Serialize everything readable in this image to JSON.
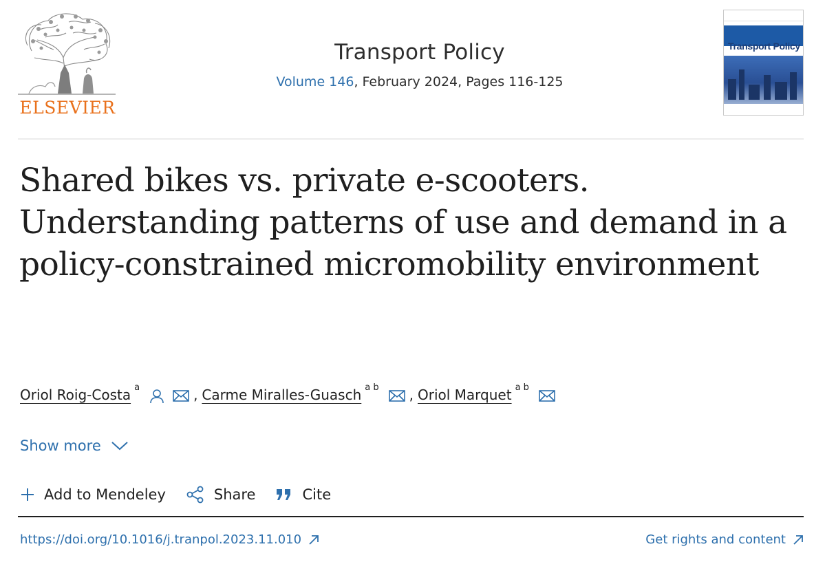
{
  "publisher": {
    "name": "ELSEVIER",
    "brand_color": "#e9711c",
    "logo_icon": "tree-logo-icon"
  },
  "journal": {
    "title": "Transport Policy",
    "volume_link": "Volume 146",
    "issue_rest": ", February 2024, Pages 116-125",
    "cover_journal_title": "Transport Policy"
  },
  "article": {
    "title": "Shared bikes vs. private e-scooters. Understanding patterns of use and demand in a policy-constrained micromobility environment"
  },
  "authors": [
    {
      "name": "Oriol Roig-Costa",
      "affiliations": "a",
      "icons": [
        "person-icon",
        "email-icon"
      ]
    },
    {
      "name": "Carme Miralles-Guasch",
      "affiliations": "a b",
      "icons": [
        "email-icon"
      ]
    },
    {
      "name": "Oriol Marquet",
      "affiliations": "a b",
      "icons": [
        "email-icon"
      ]
    }
  ],
  "separator": ",",
  "show_more": {
    "label": "Show more",
    "icon": "chevron-down-icon"
  },
  "toolbar": {
    "mendeley_label": "Add to Mendeley",
    "share_label": "Share",
    "cite_label": "Cite"
  },
  "links": {
    "doi": "https://doi.org/10.1016/j.tranpol.2023.11.010",
    "rights": "Get rights and content"
  },
  "colors": {
    "link": "#2e70ad",
    "text": "#1f1f1f"
  }
}
